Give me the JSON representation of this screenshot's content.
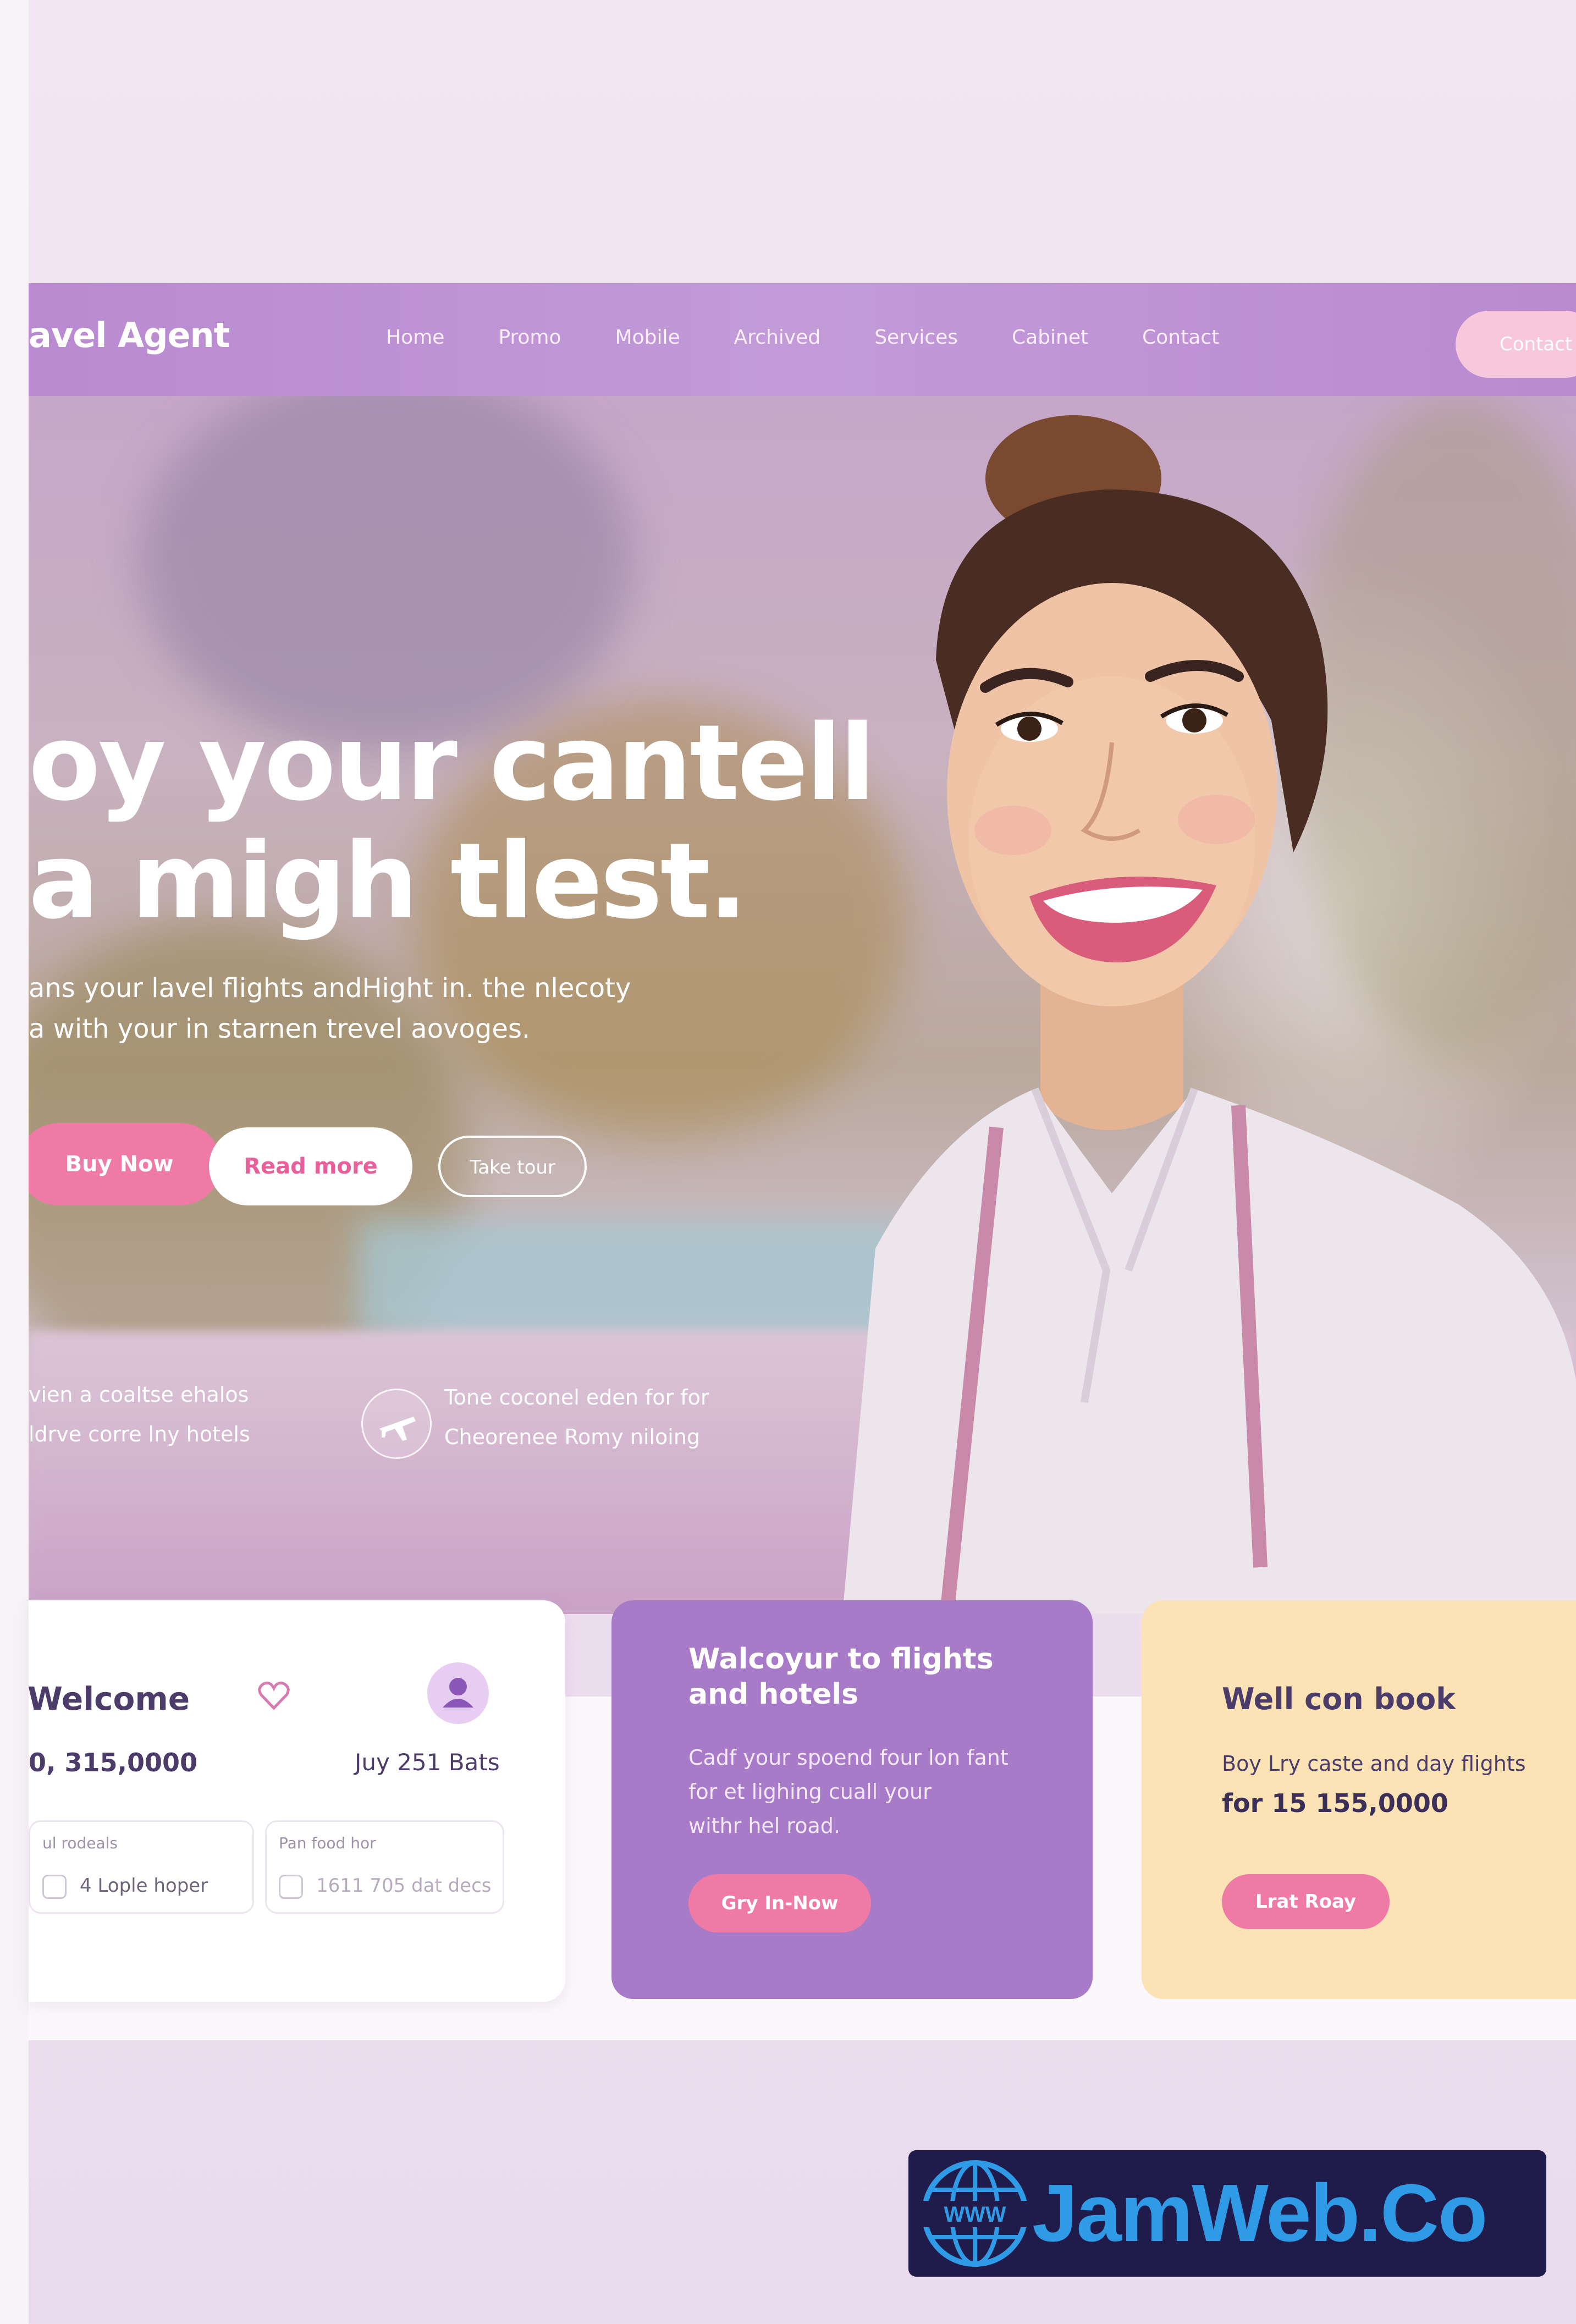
{
  "nav": {
    "brand": "avel Agent",
    "links": [
      "Home",
      "Promo",
      "Mobile",
      "Archived",
      "Services",
      "Cabinet",
      "Contact"
    ],
    "cta": "Contact us"
  },
  "hero": {
    "title_line1": "oy your cantell",
    "title_line2": "a migh tlest.",
    "subtitle_line1": "ans your lavel flights andHight in. the nlecoty",
    "subtitle_line2": "a with your in starnen trevel aovoges.",
    "btn_primary": "Buy Now",
    "btn_secondary": "Read more",
    "btn_outline": "Take tour",
    "feature1_line1": "vien a coaltse ehalos",
    "feature1_line2": "ldrve corre lny hotels",
    "feature2_line1": "Tone coconel eden for for",
    "feature2_line2": "Cheorenee Romy niloing"
  },
  "cards": {
    "welcome": {
      "title": "Welcome",
      "amount": "0, 315,0000",
      "date": "Juy 251 Bats",
      "mini1_label": "ul rodeals",
      "mini1_value": "4 Lople hoper",
      "mini2_label": "Pan food hor",
      "mini2_value": "1611 705 dat decs"
    },
    "purple": {
      "title_line1": "Walcoyur to flights",
      "title_line2": "and hotels",
      "text_line1": "Cadf your spoend four lon fant",
      "text_line2": "for et lighing cuall your",
      "text_line3": "withr hel road.",
      "button": "Gry In-Now"
    },
    "yellow": {
      "title": "Well con book",
      "text": "Boy Lry caste and day flights",
      "price": "for 15 155,0000",
      "button": "Lrat Roay"
    }
  },
  "watermark": {
    "text": "JamWeb.Co",
    "globe_label": "WWW"
  },
  "colors": {
    "nav": "#b98ad0",
    "accent_pink": "#f07aa6",
    "card_purple": "#a87bc9",
    "card_yellow": "#fbe3b5",
    "text_dark": "#4b3c6a",
    "watermark_bg": "#1f1b4a",
    "watermark_text": "#2f9be6"
  },
  "icons": [
    "heart-icon",
    "user-icon",
    "plane-icon",
    "checkbox-icon",
    "globe-icon"
  ]
}
